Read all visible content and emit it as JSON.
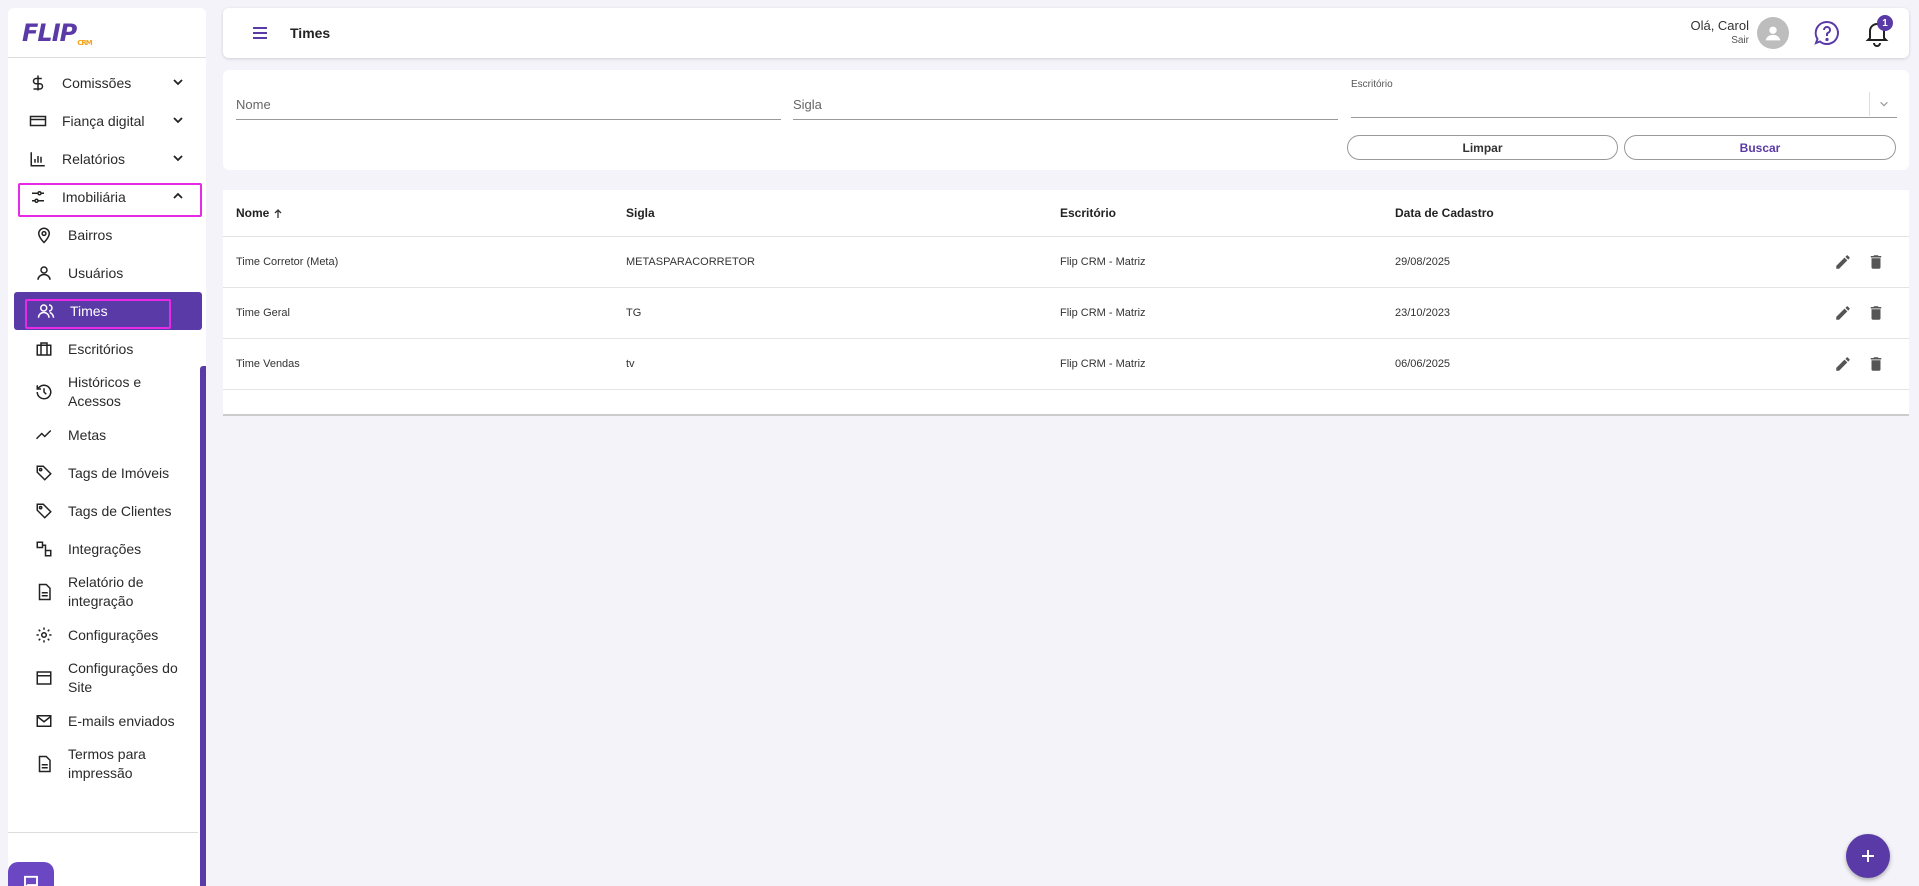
{
  "app": {
    "logo_text": "FLIP",
    "logo_suffix": "CRM",
    "page_title": "Times"
  },
  "header": {
    "greeting": "Olá, Carol",
    "logout": "Sair",
    "notifications_count": "1"
  },
  "sidebar": {
    "items": [
      {
        "label": "Comissões",
        "icon": "dollar-icon"
      },
      {
        "label": "Fiança digital",
        "icon": "credit-card-icon"
      },
      {
        "label": "Relatórios",
        "icon": "bar-chart-icon"
      },
      {
        "label": "Imobiliária",
        "icon": "sliders-icon"
      }
    ],
    "sub_items": [
      {
        "label": "Bairros",
        "icon": "map-pin-icon"
      },
      {
        "label": "Usuários",
        "icon": "user-icon"
      },
      {
        "label": "Times",
        "icon": "users-icon"
      },
      {
        "label": "Escritórios",
        "icon": "briefcase-icon"
      },
      {
        "label": "Históricos e Acessos",
        "icon": "history-icon"
      },
      {
        "label": "Metas",
        "icon": "trending-up-icon"
      },
      {
        "label": "Tags de Imóveis",
        "icon": "tag-icon"
      },
      {
        "label": "Tags de Clientes",
        "icon": "tag-icon"
      },
      {
        "label": "Integrações",
        "icon": "integration-icon"
      },
      {
        "label": "Relatório de integração",
        "icon": "file-icon"
      },
      {
        "label": "Configurações",
        "icon": "gear-icon"
      },
      {
        "label": "Configurações do Site",
        "icon": "browser-icon"
      },
      {
        "label": "E-mails enviados",
        "icon": "mail-icon"
      },
      {
        "label": "Termos para impressão",
        "icon": "file-icon"
      }
    ]
  },
  "filters": {
    "name_placeholder": "Nome",
    "code_placeholder": "Sigla",
    "office_label": "Escritório",
    "office_value": "",
    "clear_label": "Limpar",
    "search_label": "Buscar"
  },
  "table": {
    "headers": [
      "Nome",
      "Sigla",
      "Escritório",
      "Data de Cadastro"
    ],
    "rows": [
      [
        "Time Corretor (Meta)",
        "METASPARACORRETOR",
        "Flip CRM - Matriz",
        "29/08/2025"
      ],
      [
        "Time Geral",
        "TG",
        "Flip CRM - Matriz",
        "23/10/2023"
      ],
      [
        "Time Vendas",
        "tv",
        "Flip CRM - Matriz",
        "06/06/2025"
      ]
    ]
  },
  "colors": {
    "accent": "#5a3aa6",
    "highlight": "#e62ae6",
    "background": "#f3f3f9"
  }
}
